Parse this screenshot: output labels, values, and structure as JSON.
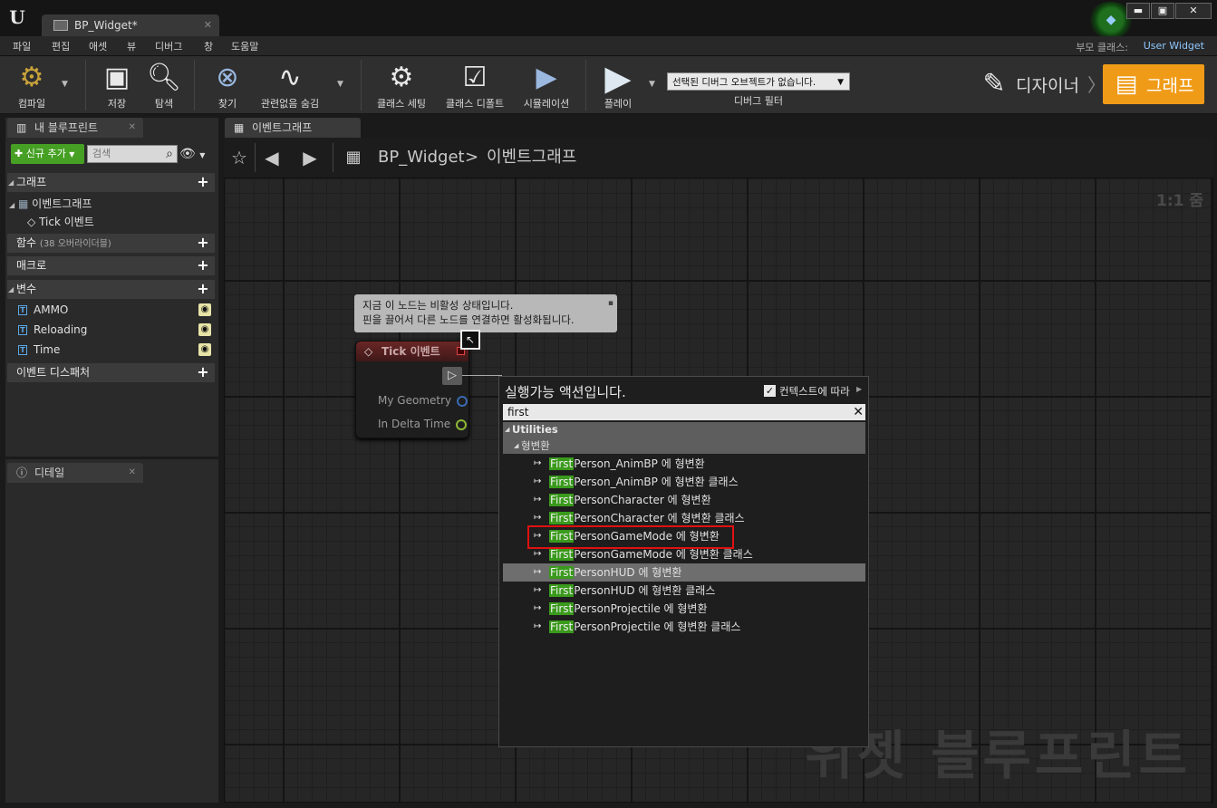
{
  "window": {
    "doc_tab": "BP_Widget*",
    "controls": [
      "▬",
      "▣",
      "✕"
    ]
  },
  "menu": [
    "파일",
    "편집",
    "애셋",
    "뷰",
    "디버그",
    "창",
    "도움말"
  ],
  "parent_class": {
    "label": "부모 클래스:",
    "value": "User Widget"
  },
  "toolbar": {
    "compile": "컴파일",
    "save": "저장",
    "browse": "탐색",
    "find": "찾기",
    "hide_unrelated": "관련없음 숨김",
    "class_settings": "클래스 세팅",
    "class_defaults": "클래스 디폴트",
    "simulation": "시뮬레이션",
    "play": "플레이",
    "debug_select": "선택된 디버그 오브젝트가 없습니다.",
    "debug_filter": "디버그 필터",
    "designer": "디자이너",
    "graph": "그래프"
  },
  "left": {
    "tab": "내 블루프린트",
    "add_new": "신규 추가",
    "search_placeholder": "검색",
    "graphs": "그래프",
    "event_graph": "이벤트그래프",
    "tick_event": "Tick 이벤트",
    "functions": "함수",
    "functions_sub": "(38 오버라이더블)",
    "macros": "매크로",
    "variables": "변수",
    "vars": [
      "AMMO",
      "Reloading",
      "Time"
    ],
    "dispatchers": "이벤트 디스패처"
  },
  "details": {
    "tab": "디테일"
  },
  "graph": {
    "tab": "이벤트그래프",
    "crumb_bp": "BP_Widget",
    "crumb_sep": ">",
    "crumb_graph": "이벤트그래프",
    "zoom": "1:1 줌",
    "watermark": "위젯 블루프린트"
  },
  "tooltip": {
    "line1": "지금 이 노드는 비활성 상태입니다.",
    "line2": "핀을 끌어서 다른 노드를 연결하면 활성화됩니다."
  },
  "node": {
    "title": "Tick 이벤트",
    "pin1": "My Geometry",
    "pin2": "In Delta Time"
  },
  "action_menu": {
    "title": "실행가능 액션입니다.",
    "context_label": "컨텍스트에 따라",
    "search_value": "first",
    "category": "Utilities",
    "subcategory": "형변환",
    "items": [
      {
        "hl": "First",
        "rest": "Person_AnimBP 에 형변환"
      },
      {
        "hl": "First",
        "rest": "Person_AnimBP 에 형변환 클래스"
      },
      {
        "hl": "First",
        "rest": "PersonCharacter 에 형변환"
      },
      {
        "hl": "First",
        "rest": "PersonCharacter 에 형변환 클래스"
      },
      {
        "hl": "First",
        "rest": "PersonGameMode 에 형변환"
      },
      {
        "hl": "First",
        "rest": "PersonGameMode 에 형변환 클래스"
      },
      {
        "hl": "First",
        "rest": "PersonHUD 에 형변환"
      },
      {
        "hl": "First",
        "rest": "PersonHUD 에 형변환 클래스"
      },
      {
        "hl": "First",
        "rest": "PersonProjectile 에 형변환"
      },
      {
        "hl": "First",
        "rest": "PersonProjectile 에 형변환 클래스"
      }
    ]
  },
  "colors": {
    "graph_accent": "#f09b17",
    "add_new_green": "#46a024",
    "search_highlight": "#3a9a1c",
    "annotation_red": "#e01010"
  }
}
